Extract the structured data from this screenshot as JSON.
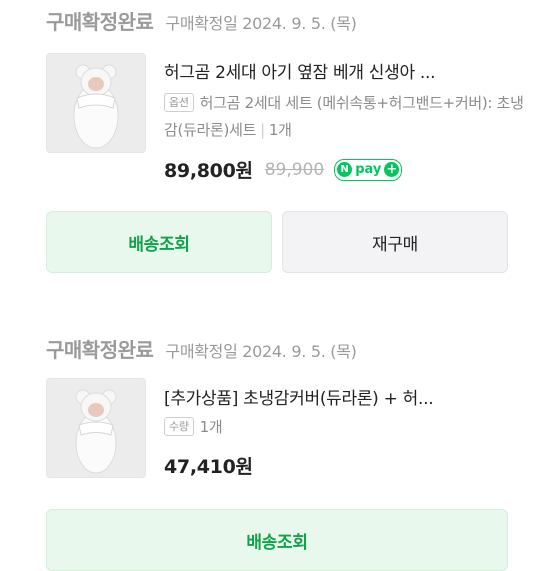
{
  "orders": [
    {
      "status": "구매확정완료",
      "date": "구매확정일 2024. 9. 5. (목)",
      "product_title": "허그곰 2세대 아기 옆잠 베개 신생아 ...",
      "option_tag": "옵션",
      "option_text": "허그곰 2세대 세트 (메쉬속통+허그밴드+커버): 초냉감(듀라론)세트",
      "quantity": "1개",
      "price": "89,800원",
      "original_price": "89,900",
      "npay": {
        "n": "N",
        "label": "pay",
        "plus": "+"
      },
      "buttons": {
        "track": "배송조회",
        "reorder": "재구매"
      }
    },
    {
      "status": "구매확정완료",
      "date": "구매확정일 2024. 9. 5. (목)",
      "product_title": "[추가상품] 초냉감커버(듀라론) + 허...",
      "option_tag": "수량",
      "quantity": "1개",
      "price": "47,410원",
      "buttons": {
        "track": "배송조회"
      }
    }
  ],
  "colors": {
    "accent_green": "#03c75a",
    "button_green_text": "#11a24a",
    "status_gray": "#9a9a9a"
  },
  "icons": [
    "product-thumbnail",
    "npay-icon"
  ]
}
